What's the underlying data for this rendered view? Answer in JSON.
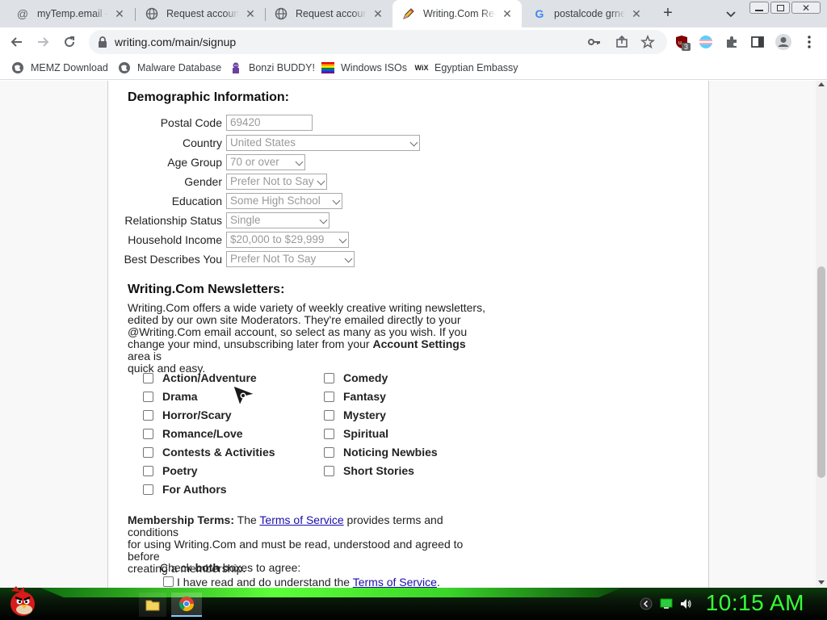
{
  "browser": {
    "tabs": [
      {
        "title": "myTemp.email - Ill",
        "icon": "at-icon"
      },
      {
        "title": "Request account - ",
        "icon": "globe-icon"
      },
      {
        "title": "Request account - ",
        "icon": "globe-icon"
      },
      {
        "title": "Writing.Com Regi",
        "icon": "pencil-icon"
      },
      {
        "title": "postalcode grnera",
        "icon": "google-icon"
      }
    ],
    "url": "writing.com/main/signup",
    "bookmarks": [
      {
        "label": "MEMZ Download",
        "icon": "globe-icon"
      },
      {
        "label": "Malware Database",
        "icon": "globe-icon"
      },
      {
        "label": "Bonzi BUDDY!",
        "icon": "gorilla-icon"
      },
      {
        "label": "Windows ISOs",
        "icon": "rainbow-flag-icon"
      },
      {
        "label": "Egyptian Embassy",
        "icon": "wix-icon"
      }
    ],
    "extension_badge": "3"
  },
  "demographics": {
    "heading": "Demographic Information:",
    "postal_code": {
      "label": "Postal Code",
      "value": "69420"
    },
    "country": {
      "label": "Country",
      "value": "United States"
    },
    "age_group": {
      "label": "Age Group",
      "value": "70 or over"
    },
    "gender": {
      "label": "Gender",
      "value": "Prefer Not to Say"
    },
    "education": {
      "label": "Education",
      "value": "Some High School"
    },
    "relationship": {
      "label": "Relationship Status",
      "value": "Single"
    },
    "income": {
      "label": "Household Income",
      "value": "$20,000 to $29,999"
    },
    "describes": {
      "label": "Best Describes You",
      "value": "Prefer Not To Say"
    }
  },
  "newsletters": {
    "heading": "Writing.Com Newsletters:",
    "intro_lines": [
      "Writing.Com offers a wide variety of weekly creative writing newsletters,",
      "edited by our own site Moderators. They're emailed directly to your",
      "@Writing.Com email account, so select as many as you wish. If you",
      "change your mind, unsubscribing later from your "
    ],
    "intro_bold": "Account Settings",
    "intro_tail": " area is",
    "intro_last": "quick and easy.",
    "left_options": [
      "Action/Adventure",
      "Drama",
      "Horror/Scary",
      "Romance/Love",
      "Contests & Activities",
      "Poetry",
      "For Authors"
    ],
    "right_options": [
      "Comedy",
      "Fantasy",
      "Mystery",
      "Spiritual",
      "Noticing Newbies",
      "Short Stories"
    ]
  },
  "terms": {
    "bold": "Membership Terms:",
    "pre_link": " The ",
    "link": "Terms of Service",
    "post_link": " provides terms and conditions",
    "line2": "for using Writing.Com and must be read, understood and agreed to before",
    "line3": "creating a membership.",
    "check_pre": "Check ",
    "check_bold": "both",
    "check_post": " boxes to agree:",
    "agree1_pre": "I have read and do understand the ",
    "agree1_link": "Terms of Service",
    "agree1_post": "."
  },
  "taskbar": {
    "clock": "10:15 AM"
  },
  "colors": {
    "link": "#1a0dab",
    "clock": "#36ff3a",
    "taskbar_glow": "#5dff3a"
  }
}
